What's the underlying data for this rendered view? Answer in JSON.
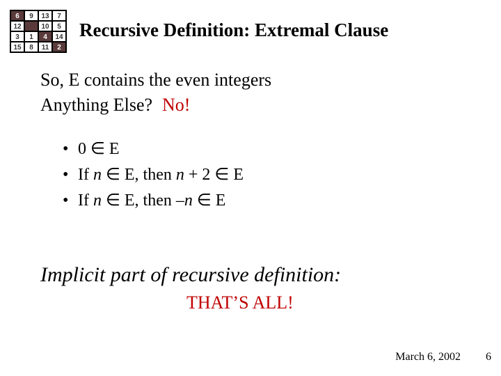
{
  "icon": {
    "cells": [
      {
        "v": "6",
        "dark": true
      },
      {
        "v": "9",
        "dark": false
      },
      {
        "v": "13",
        "dark": false
      },
      {
        "v": "7",
        "dark": false
      },
      {
        "v": "12",
        "dark": false
      },
      {
        "v": "",
        "dark": true
      },
      {
        "v": "10",
        "dark": false
      },
      {
        "v": "5",
        "dark": false
      },
      {
        "v": "3",
        "dark": false
      },
      {
        "v": "1",
        "dark": false
      },
      {
        "v": "4",
        "dark": true
      },
      {
        "v": "14",
        "dark": false
      },
      {
        "v": "15",
        "dark": false
      },
      {
        "v": "8",
        "dark": false
      },
      {
        "v": "11",
        "dark": false
      },
      {
        "v": "2",
        "dark": true
      }
    ]
  },
  "title": "Recursive Definition: Extremal Clause",
  "contains": "So, E contains the even integers",
  "anything": {
    "question": "Anything Else?",
    "answer": "No!"
  },
  "bullets": {
    "b": "•",
    "items": [
      {
        "pre": "0 ",
        "mid": "∈",
        "post": " E"
      },
      {
        "pre": "If ",
        "var1": "n",
        "mid1": " ∈ E, then ",
        "var2": "n",
        "mid2": " + 2 ∈ E"
      },
      {
        "pre": "If ",
        "var1": "n",
        "mid1": " ∈ E, then –",
        "var2": "n",
        "mid2": " ∈ E"
      }
    ]
  },
  "implicit": "Implicit part of recursive definition:",
  "thatsall": "THAT’S ALL!",
  "footer": {
    "date": "March 6, 2002",
    "page": "6"
  }
}
